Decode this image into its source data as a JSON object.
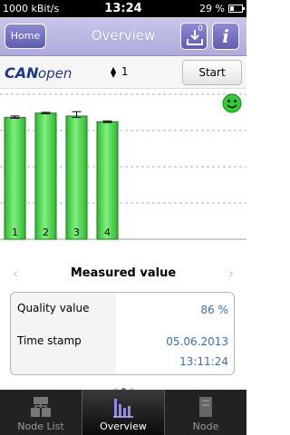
{
  "status_bar": {
    "bitrate": "1000 kBit/s",
    "time": "13:24",
    "battery": "29 %",
    "battery_level_percent": 29
  },
  "header": {
    "home_label": "Home",
    "title": "Overview",
    "download_count": "0",
    "info_label": "i"
  },
  "toolbar": {
    "logo_text_1": "CAN",
    "logo_text_2": "open",
    "node_value": "1",
    "start_label": "Start"
  },
  "status_icon": "smiley-green-icon",
  "chart_data": {
    "type": "bar",
    "categories": [
      "1",
      "2",
      "3",
      "4"
    ],
    "values": [
      84,
      87,
      85,
      81
    ],
    "error_high": [
      85,
      87.5,
      88,
      81.5
    ],
    "error_low": [
      83.5,
      86.5,
      84,
      80.5
    ],
    "ylim": [
      0,
      100
    ],
    "grid": true,
    "bar_color": "#3fd43f"
  },
  "pager": {
    "title": "Measured value",
    "prev_icon": "chevron-left-icon",
    "next_icon": "chevron-right-icon",
    "page_count": 3,
    "active_page": 2
  },
  "measurement": {
    "quality_label": "Quality value",
    "quality_value": "86 %",
    "timestamp_label": "Time stamp",
    "timestamp_date": "05.06.2013",
    "timestamp_time": "13:11:24"
  },
  "tabs": [
    {
      "label": "Node List",
      "icon": "node-list-icon",
      "active": false
    },
    {
      "label": "Overview",
      "icon": "bar-chart-icon",
      "active": true
    },
    {
      "label": "Node",
      "icon": "node-icon",
      "active": false
    }
  ],
  "colors": {
    "header_bg": "#aeaadc",
    "button_bg": "#5f5cb4",
    "value_text": "#3a6fb6",
    "bar_fill": "#3fd43f"
  }
}
